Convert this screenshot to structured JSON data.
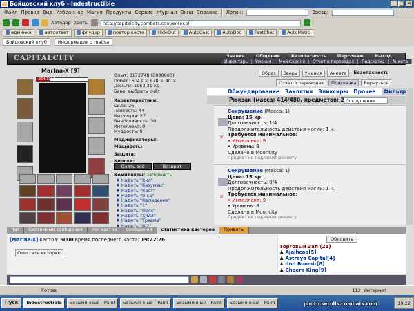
{
  "window": {
    "title": "Бойцовский клуб - Indestructible"
  },
  "menu": {
    "items": [
      "Файл",
      "Правка",
      "Вид",
      "Избранное",
      "Магия",
      "Продукты",
      "Сервис",
      "Журнал",
      "Окна",
      "Справка"
    ],
    "login_label": "Логин:",
    "servers_label": "Звезд:"
  },
  "toolbar": {
    "autodar": "Автодар",
    "hotkeys": "Хаоты",
    "address": "http://capitalcity.combats.com/enter.pl"
  },
  "links": {
    "items": [
      "админка",
      "автоответ",
      "флудер",
      "повтор каста",
      "HideOut",
      "AutoCast",
      "AutoDoc",
      "FastChat",
      "AutoMetro"
    ]
  },
  "tabs": {
    "items": [
      "Бойцовский клуб",
      "Информация о matisa"
    ]
  },
  "game": {
    "logo": "CAPITALCITY",
    "nav_top": [
      "Знания",
      "Общение",
      "Безопасность",
      "Персонаж",
      "Выход"
    ],
    "nav_sub": [
      "Инвентарь",
      "Умения",
      "Мой Скролл",
      "Отчет о переводах",
      "Подсказка",
      "Анкета"
    ],
    "char": {
      "name": "Marina-X [9]",
      "hp": "264/1014",
      "btn_remove": "Снять всё",
      "btn_back": "Возврат"
    },
    "stats": {
      "exp": "Опыт: 3172748 (6000000)",
      "wins": "Побед: 6043 ⚔ 678 ⚔ 40 ⚔",
      "money": "Деньги: 1953.31 кр.",
      "bank": "Банк: выбрать счёт",
      "chars_title": "Характеристики:",
      "str": "Сила: 26",
      "agi": "Ловкость: 44",
      "int": "Интуиция: 27",
      "vit": "Выносливость: 30",
      "intel": "Интеллект: 0",
      "wis": "Мудрость: 0",
      "mods": "Модификаторы:",
      "power": "Мощность:",
      "defense": "Защита:",
      "buttons": "Кнопки:",
      "sets": "Комплекты:",
      "remember": "запомнить"
    },
    "sets": [
      "Надеть \"Хил\"",
      "Надеть \"Безумец\"",
      "Надеть \"Каст\"",
      "Надеть \"9-ка\"",
      "Надеть \"Нападение\"",
      "Надеть \"1\"",
      "Надеть \"Пояс\"",
      "Надеть \"Хил2\"",
      "Надеть \"Травма\"",
      "Надеть \"6-2\""
    ],
    "topbtns": [
      "Образ",
      "Зверь",
      "Умения",
      "Анкета",
      "Безопасность"
    ],
    "topbtns2": [
      "Отчет о переводах",
      "Подсказка",
      "Вернуться"
    ],
    "filters": [
      "Обмундирование",
      "Заклятия",
      "Эликсиры",
      "Прочее",
      "Фильтр"
    ],
    "rucksack": "Рюкзак (масса: 414/480, предметов: 203)",
    "search_value": "Сокрушение",
    "items": [
      {
        "name": "Сокрушение",
        "mass": "(Масса: 1)",
        "price": "Цена: 15 кр.",
        "dur": "Долговечность: 1/4",
        "duration": "Продолжительность действия магии: 1 ч.",
        "req": "Требуется минимальное:",
        "intel": "• Интеллект: 9",
        "level": "• Уровень: 8",
        "made": "Сделано в Mooncity",
        "note": "Предмет не подлежит ремонту"
      },
      {
        "name": "Сокрушение",
        "mass": "(Масса: 1)",
        "price": "Цена: 15 кр.",
        "dur": "Долговечность: 0/4",
        "duration": "Продолжительность действия магии: 1 ч.",
        "req": "Требуется минимальное:",
        "intel": "• Интеллект: 9",
        "level": "• Уровень: 8",
        "made": "Сделано в Mooncity",
        "note": "Предмет не подлежит ремонту"
      }
    ],
    "chat_tabs": [
      "Чат",
      "Системные сообщения",
      "лог кастов",
      "сообщения",
      "статистика кастеров",
      "Приваты"
    ],
    "chat": {
      "user": "[Marina-X]",
      "msg": "кастов:",
      "count": "5000",
      "time_label": "время последнего каста:",
      "time": "19:22:26",
      "clear": "Очистить историю"
    },
    "users": {
      "refresh": "Обновить",
      "room": "Торговый Зал (21)",
      "list": [
        "Ajaihcap[5]",
        "Astreya Capital[4]",
        "dnd Boomir[8]",
        "Cheera King[9]"
      ]
    }
  },
  "status": {
    "done": "Готово",
    "zone": "Интернет",
    "page": "112"
  },
  "taskbar": {
    "start": "Пуск",
    "items": [
      "Indestructible",
      "Безымянный - Paint",
      "Безымянный - Paint",
      "Безымянный - Paint",
      "Безымянный - Paint"
    ],
    "time": "19:22"
  },
  "watermark": "photo.serolls.combats.com"
}
